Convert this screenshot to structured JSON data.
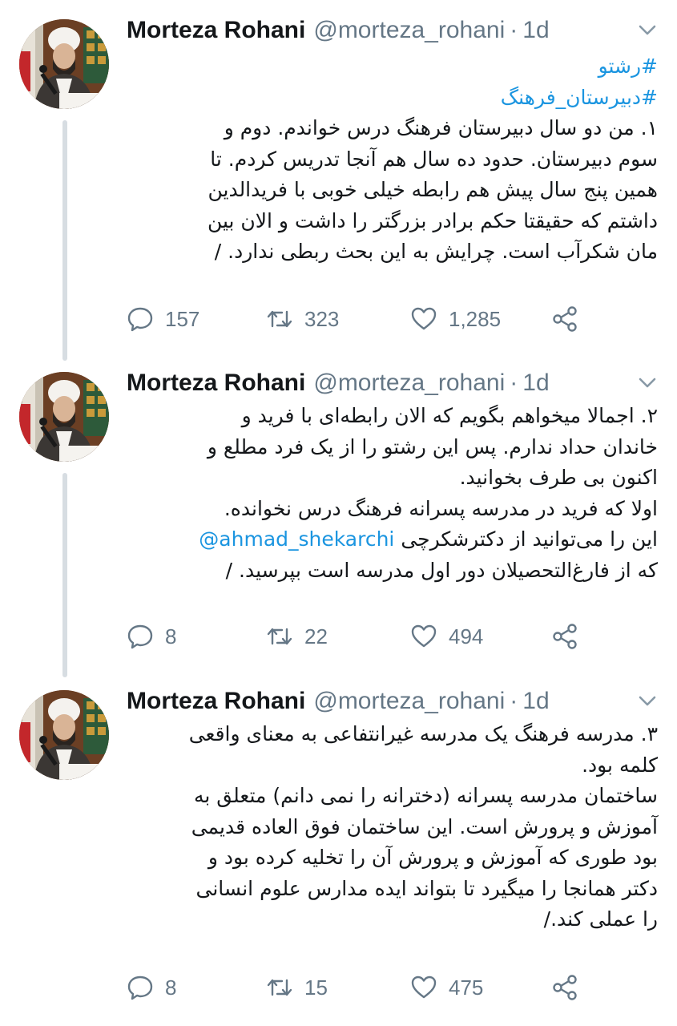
{
  "colors": {
    "link": "#1b95e0",
    "secondary_text": "#657786",
    "thread_line": "#d7dde2"
  },
  "tweets": [
    {
      "author": {
        "name": "Morteza Rohani",
        "handle": "@morteza_rohani",
        "time": "1d",
        "separator": "·"
      },
      "hashtags": [
        "#رشتو",
        "#دبیرستان_فرهنگ"
      ],
      "lines": [
        "۱. من دو سال دبیرستان فرهنگ درس خواندم. دوم و",
        "سوم دبیرستان. حدود ده سال هم آنجا تدریس کردم. تا",
        "همین پنج سال پیش هم رابطه خیلی خوبی با فریدالدین",
        "داشتم که حقیقتا حکم برادر بزرگتر را داشت و الان بین",
        "مان شکرآب است. چرایش به این بحث ربطی ندارد. /"
      ],
      "stats": {
        "replies": "157",
        "retweets": "323",
        "likes": "1,285"
      }
    },
    {
      "author": {
        "name": "Morteza Rohani",
        "handle": "@morteza_rohani",
        "time": "1d",
        "separator": "·"
      },
      "lines": [
        "۲. اجمالا میخواهم بگویم که الان رابطه‌ای با فرید و",
        "خاندان حداد ندارم. پس این رشتو را از یک فرد مطلع و",
        "اکنون بی طرف بخوانید.",
        "اولا که فرید در مدرسه پسرانه فرهنگ درس نخوانده.",
        "این را می‌توانید از دکترشکرچی",
        "که از فارغ‌التحصیلان دور اول مدرسه است بپرسید. /"
      ],
      "mention": "@ahmad_shekarchi",
      "stats": {
        "replies": "8",
        "retweets": "22",
        "likes": "494"
      }
    },
    {
      "author": {
        "name": "Morteza Rohani",
        "handle": "@morteza_rohani",
        "time": "1d",
        "separator": "·"
      },
      "lines": [
        "۳. مدرسه فرهنگ یک مدرسه غیرانتفاعی به معنای واقعی",
        "کلمه بود.",
        "ساختمان مدرسه پسرانه (دخترانه را نمی دانم) متعلق به",
        "آموزش و پرورش است.  این ساختمان فوق العاده قدیمی",
        "بود طوری که آموزش و پرورش آن را تخلیه کرده بود و",
        "دکتر همانجا را میگیرد تا بتواند ایده مدارس علوم انسانی",
        "را عملی کند./"
      ],
      "stats": {
        "replies": "8",
        "retweets": "15",
        "likes": "475"
      }
    }
  ],
  "icons": {
    "reply": "reply-icon",
    "retweet": "retweet-icon",
    "like": "heart-icon",
    "share": "share-icon",
    "caret": "chevron-down-icon"
  }
}
